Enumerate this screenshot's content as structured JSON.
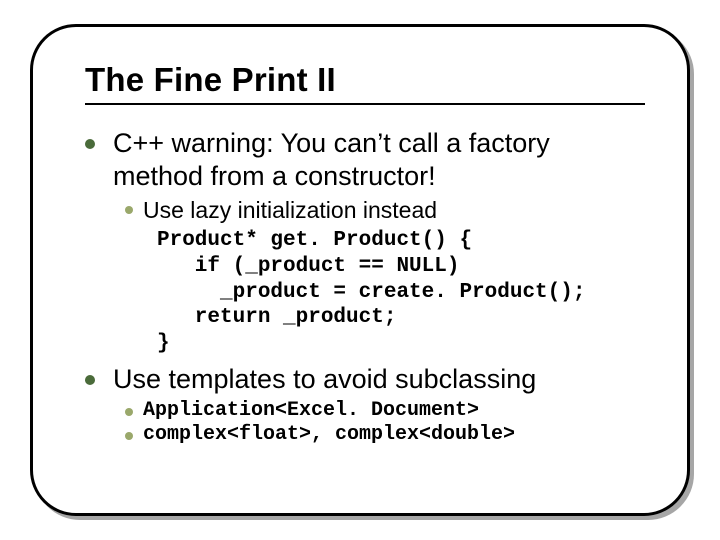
{
  "title": "The Fine Print II",
  "bullets": [
    {
      "text": "C++ warning: You can’t call a factory method from a constructor!",
      "sub": [
        {
          "text": "Use lazy initialization instead",
          "mono": false
        }
      ],
      "code": "Product* get. Product() {\n   if (_product == NULL)\n     _product = create. Product();\n   return _product;\n}"
    },
    {
      "text": "Use templates to avoid subclassing",
      "sub": [
        {
          "text": "Application<Excel. Document>",
          "mono": true
        },
        {
          "text": "complex<float>, complex<double>",
          "mono": true
        }
      ]
    }
  ]
}
